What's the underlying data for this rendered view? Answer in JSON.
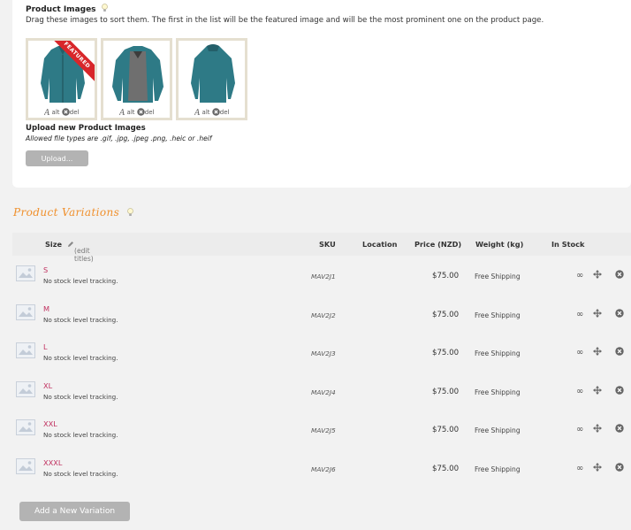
{
  "images": {
    "title": "Product Images",
    "help": "Drag these images to sort them. The first in the list will be the featured image and will be the most prominent one on the product page.",
    "featured_badge": "FEATURED",
    "alt_label": "alt",
    "del_label": "del",
    "upload_title": "Upload new Product Images",
    "upload_note": "Allowed file types are .gif, .jpg, .jpeg .png, .heic or .heif",
    "upload_button": "Upload..."
  },
  "variations": {
    "title": "Product Variations",
    "headers": {
      "size": "Size",
      "edit_titles": "(edit titles)",
      "sku": "SKU",
      "location": "Location",
      "price": "Price (NZD)",
      "weight": "Weight (kg)",
      "in_stock": "In Stock"
    },
    "rows": [
      {
        "size": "S",
        "tracking": "No stock level tracking.",
        "sku": "MAV2J1",
        "price": "$75.00",
        "weight": "Free Shipping",
        "stock": "∞"
      },
      {
        "size": "M",
        "tracking": "No stock level tracking.",
        "sku": "MAV2J2",
        "price": "$75.00",
        "weight": "Free Shipping",
        "stock": "∞"
      },
      {
        "size": "L",
        "tracking": "No stock level tracking.",
        "sku": "MAV2J3",
        "price": "$75.00",
        "weight": "Free Shipping",
        "stock": "∞"
      },
      {
        "size": "XL",
        "tracking": "No stock level tracking.",
        "sku": "MAV2J4",
        "price": "$75.00",
        "weight": "Free Shipping",
        "stock": "∞"
      },
      {
        "size": "XXL",
        "tracking": "No stock level tracking.",
        "sku": "MAV2J5",
        "price": "$75.00",
        "weight": "Free Shipping",
        "stock": "∞"
      },
      {
        "size": "XXXL",
        "tracking": "No stock level tracking.",
        "sku": "MAV2J6",
        "price": "$75.00",
        "weight": "Free Shipping",
        "stock": "∞"
      }
    ],
    "add_button": "Add a New Variation"
  },
  "colors": {
    "accent_orange": "#f0902c",
    "size_link": "#c0305f",
    "button_grey": "#b3b3b3",
    "featured_red": "#d8262a",
    "jacket_teal": "#2e7a86"
  }
}
